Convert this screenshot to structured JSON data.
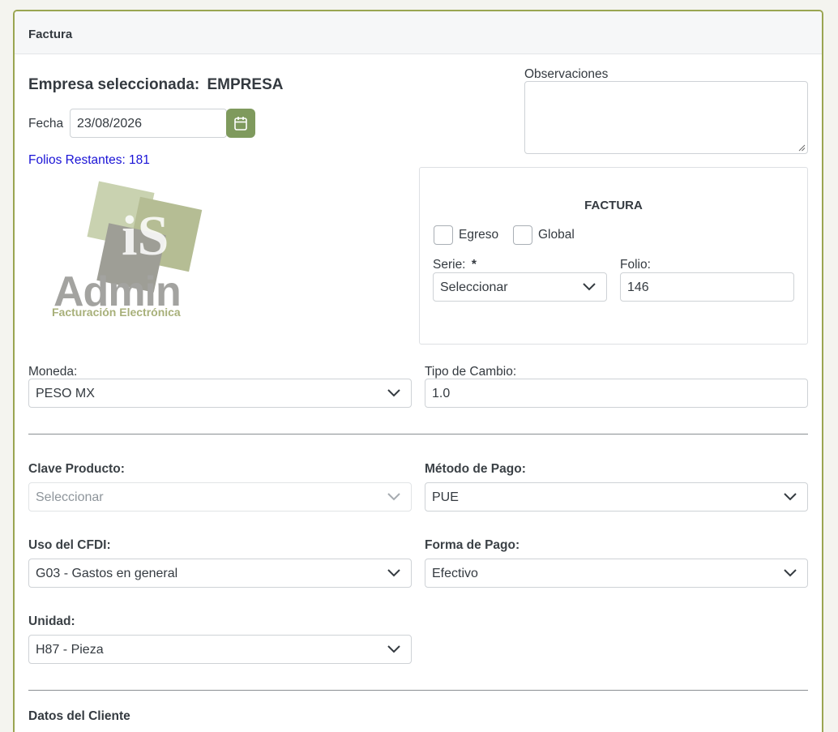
{
  "card": {
    "title": "Factura"
  },
  "empresa": {
    "label": "Empresa seleccionada:",
    "name": "EMPRESA"
  },
  "fecha": {
    "label": "Fecha",
    "value": "23/08/2026"
  },
  "folios": {
    "text": "Folios Restantes: 181"
  },
  "logo": {
    "text": "Admin",
    "subtitle": "Facturación Electrónica"
  },
  "observaciones": {
    "label": "Observaciones",
    "value": ""
  },
  "factura_box": {
    "title": "FACTURA",
    "egreso_label": "Egreso",
    "global_label": "Global",
    "serie_label": "Serie:",
    "serie_required": "*",
    "serie_value": "Seleccionar",
    "folio_label": "Folio:",
    "folio_value": "146"
  },
  "moneda": {
    "label": "Moneda:",
    "value": "PESO MX"
  },
  "tipo_cambio": {
    "label": "Tipo de Cambio:",
    "value": "1.0"
  },
  "clave_producto": {
    "label": "Clave Producto:",
    "value": "Seleccionar"
  },
  "metodo_pago": {
    "label": "Método de Pago:",
    "value": "PUE"
  },
  "uso_cfdi": {
    "label": "Uso del CFDI:",
    "value": "G03 - Gastos en general"
  },
  "forma_pago": {
    "label": "Forma de Pago:",
    "value": "Efectivo"
  },
  "unidad": {
    "label": "Unidad:",
    "value": "H87 - Pieza"
  },
  "cliente": {
    "title": "Datos del Cliente"
  },
  "colors": {
    "accent": "#7f9a5d",
    "card_border": "#9aa551",
    "link_blue": "#1a13d6"
  }
}
